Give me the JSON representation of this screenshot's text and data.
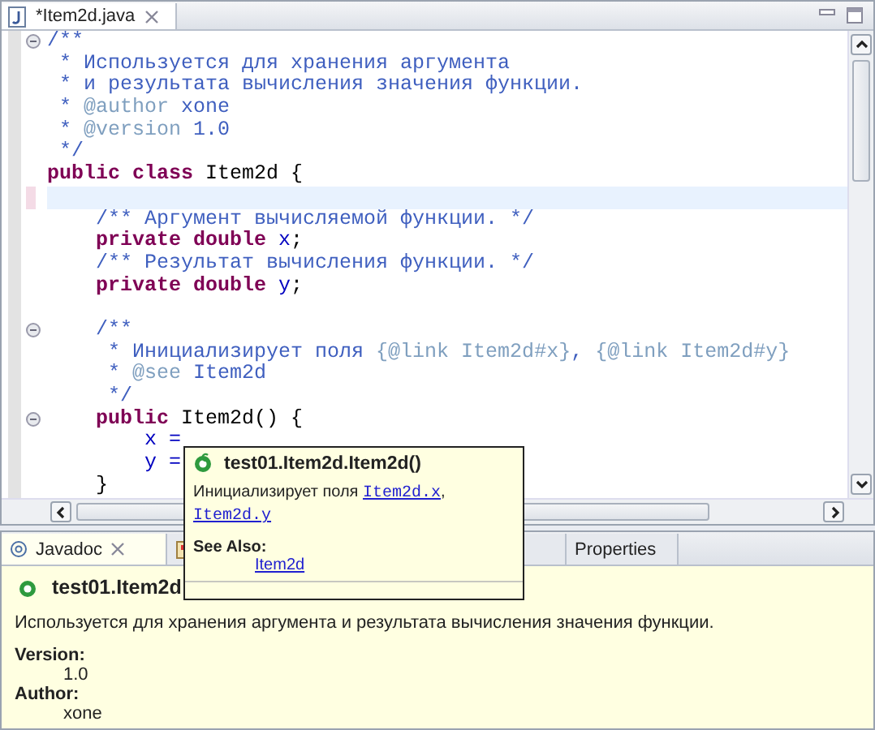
{
  "editor": {
    "tab": {
      "title": "*Item2d.java",
      "selected": true
    },
    "lines": [
      {
        "fold": true,
        "current": false,
        "segments": [
          {
            "kind": "doc",
            "text": "/**"
          }
        ]
      },
      {
        "fold": false,
        "current": false,
        "segments": [
          {
            "kind": "doc",
            "text": " * Используется для хранения аргумента"
          }
        ]
      },
      {
        "fold": false,
        "current": false,
        "segments": [
          {
            "kind": "doc",
            "text": " * и результата вычисления значения функции."
          }
        ]
      },
      {
        "fold": false,
        "current": false,
        "segments": [
          {
            "kind": "doc",
            "text": " * "
          },
          {
            "kind": "tag",
            "text": "@author"
          },
          {
            "kind": "doc",
            "text": " xone"
          }
        ]
      },
      {
        "fold": false,
        "current": false,
        "segments": [
          {
            "kind": "doc",
            "text": " * "
          },
          {
            "kind": "tag",
            "text": "@version"
          },
          {
            "kind": "doc",
            "text": " 1.0"
          }
        ]
      },
      {
        "fold": false,
        "current": false,
        "segments": [
          {
            "kind": "doc",
            "text": " */"
          }
        ]
      },
      {
        "fold": false,
        "current": false,
        "segments": [
          {
            "kind": "keyword",
            "text": "public class"
          },
          {
            "kind": "plain",
            "text": " Item2d {"
          }
        ]
      },
      {
        "fold": false,
        "current": true
      },
      {
        "fold": false,
        "current": false,
        "segments": [
          {
            "kind": "doc",
            "text": "    /** Аргумент вычисляемой функции. */"
          }
        ]
      },
      {
        "fold": false,
        "current": false,
        "segments": [
          {
            "kind": "keyword",
            "text": "    private double"
          },
          {
            "kind": "field",
            "text": " x"
          },
          {
            "kind": "plain",
            "text": ";"
          }
        ]
      },
      {
        "fold": false,
        "current": false,
        "segments": [
          {
            "kind": "doc",
            "text": "    /** Результат вычисления функции. */"
          }
        ]
      },
      {
        "fold": false,
        "current": false,
        "segments": [
          {
            "kind": "keyword",
            "text": "    private double"
          },
          {
            "kind": "field",
            "text": " y"
          },
          {
            "kind": "plain",
            "text": ";"
          }
        ]
      },
      {
        "fold": false,
        "current": false
      },
      {
        "fold": true,
        "current": false,
        "segments": [
          {
            "kind": "doc",
            "text": "    /**"
          }
        ]
      },
      {
        "fold": false,
        "current": false,
        "segments": [
          {
            "kind": "doc",
            "text": "     * Инициализирует поля "
          },
          {
            "kind": "tag",
            "text": "{@link Item2d#x}"
          },
          {
            "kind": "doc",
            "text": ", "
          },
          {
            "kind": "tag",
            "text": "{@link Item2d#y}"
          }
        ]
      },
      {
        "fold": false,
        "current": false,
        "segments": [
          {
            "kind": "doc",
            "text": "     * "
          },
          {
            "kind": "tag",
            "text": "@see"
          },
          {
            "kind": "doc",
            "text": " Item2d"
          }
        ]
      },
      {
        "fold": false,
        "current": false,
        "segments": [
          {
            "kind": "doc",
            "text": "     */"
          }
        ]
      },
      {
        "fold": true,
        "current": false,
        "segments": [
          {
            "kind": "keyword",
            "text": "    public"
          },
          {
            "kind": "plain",
            "text": " Item2d() {"
          }
        ]
      },
      {
        "fold": false,
        "current": false,
        "segments": [
          {
            "kind": "field",
            "text": "        x ="
          }
        ]
      },
      {
        "fold": false,
        "current": false,
        "segments": [
          {
            "kind": "field",
            "text": "        y ="
          }
        ]
      },
      {
        "fold": false,
        "current": false,
        "segments": [
          {
            "kind": "plain",
            "text": "    }"
          }
        ]
      }
    ]
  },
  "hover": {
    "title": "test01.Item2d.Item2d()",
    "text": "Инициализирует поля",
    "links": [
      "Item2d.x",
      "Item2d.y"
    ],
    "separator": ",",
    "see_also_label": "See Also:",
    "see_also": [
      "Item2d"
    ]
  },
  "panel": {
    "tabs": [
      {
        "label": "Javadoc",
        "kind": "javadoc",
        "selected": true,
        "closable": true
      },
      {
        "kind": "declaration",
        "selected": false,
        "closable": false
      },
      {
        "label": "Properties",
        "kind": "properties",
        "selected": false,
        "closable": false
      }
    ],
    "title": "test01.Item2d",
    "description": "Используется для хранения аргумента и результата вычисления значения функции.",
    "fields": [
      {
        "label": "Version:",
        "value": "1.0"
      },
      {
        "label": "Author:",
        "value": "xone"
      }
    ]
  }
}
